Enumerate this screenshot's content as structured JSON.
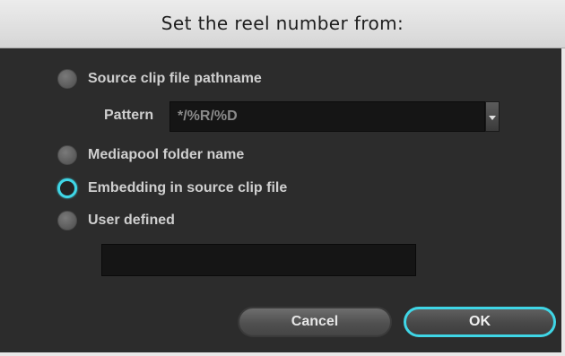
{
  "dialog": {
    "title": "Set the reel number from:"
  },
  "options": [
    {
      "label": "Source clip file pathname",
      "selected": false
    },
    {
      "label": "Mediapool folder name",
      "selected": false
    },
    {
      "label": "Embedding in source clip file",
      "selected": true
    },
    {
      "label": "User defined",
      "selected": false
    }
  ],
  "pattern": {
    "label": "Pattern",
    "value": "*/%R/%D"
  },
  "user_defined": {
    "value": ""
  },
  "buttons": {
    "cancel": "Cancel",
    "ok": "OK"
  },
  "colors": {
    "accent": "#3fd6e6",
    "dialog_background": "#2c2c2c",
    "titlebar_background": "#e2e2e2"
  }
}
